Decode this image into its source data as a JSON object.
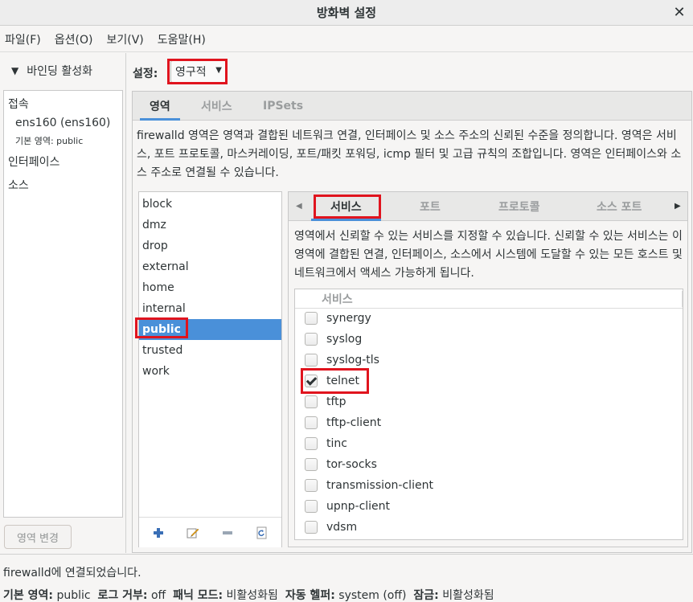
{
  "window": {
    "title": "방화벽 설정"
  },
  "menu": [
    "파일(F)",
    "옵션(O)",
    "보기(V)",
    "도움말(H)"
  ],
  "left": {
    "binding_label": "바인딩 활성화",
    "connections_header": "접속",
    "connection_name": "ens160 (ens160)",
    "default_zone_label": "기본 영역: public",
    "interfaces_header": "인터페이스",
    "sources_header": "소스",
    "change_zone_button": "영역 변경"
  },
  "config": {
    "label": "설정:",
    "value": "영구적"
  },
  "outer_tabs": [
    "영역",
    "서비스",
    "IPSets"
  ],
  "zone_description": "firewalld 영역은 영역과 결합된 네트워크 연결, 인터페이스 및 소스 주소의 신뢰된 수준을 정의합니다. 영역은 서비스, 포트 프로토콜, 마스커레이딩, 포트/패킷 포워딩, icmp 필터 및 고급 규칙의 조합입니다. 영역은 인터페이스와 소스 주소로 연결될 수 있습니다.",
  "zones": [
    "block",
    "dmz",
    "drop",
    "external",
    "home",
    "internal",
    "public",
    "trusted",
    "work"
  ],
  "selected_zone": "public",
  "inner_tabs": [
    "서비스",
    "포트",
    "프로토콜",
    "소스 포트"
  ],
  "service_description": "영역에서 신뢰할 수 있는 서비스를 지정할 수 있습니다. 신뢰할 수 있는 서비스는 이 영역에 결합된 연결, 인터페이스, 소스에서 시스템에 도달할 수 있는 모든 호스트 및 네트워크에서 액세스 가능하게 됩니다.",
  "service_column_header": "서비스",
  "services": [
    {
      "name": "synergy",
      "checked": false
    },
    {
      "name": "syslog",
      "checked": false
    },
    {
      "name": "syslog-tls",
      "checked": false
    },
    {
      "name": "telnet",
      "checked": true
    },
    {
      "name": "tftp",
      "checked": false
    },
    {
      "name": "tftp-client",
      "checked": false
    },
    {
      "name": "tinc",
      "checked": false
    },
    {
      "name": "tor-socks",
      "checked": false
    },
    {
      "name": "transmission-client",
      "checked": false
    },
    {
      "name": "upnp-client",
      "checked": false
    },
    {
      "name": "vdsm",
      "checked": false
    }
  ],
  "status": {
    "message": "firewalld에 연결되었습니다.",
    "default_zone_label": "기본 영역:",
    "default_zone_value": "public",
    "log_denied_label": "로그 거부:",
    "log_denied_value": "off",
    "panic_label": "패닉 모드:",
    "panic_value": "비활성화됨",
    "helper_label": "자동 헬퍼:",
    "helper_value": "system (off)",
    "lock_label": "잠금:",
    "lock_value": "비활성화됨"
  },
  "colors": {
    "accent": "#4a90d9",
    "highlight": "#e0141e"
  }
}
